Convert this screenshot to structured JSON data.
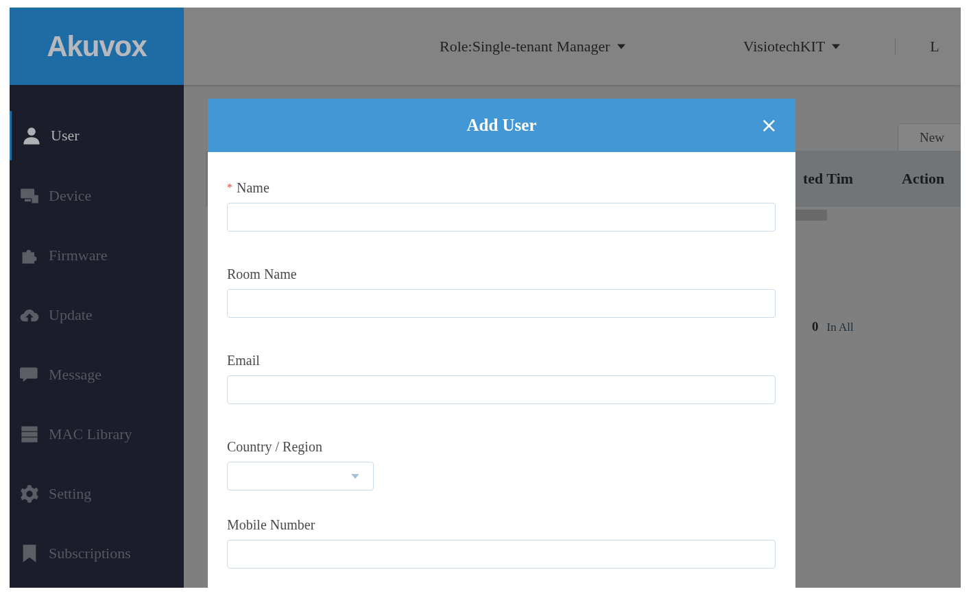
{
  "logo": "Akuvox",
  "header": {
    "role_menu": "Role:Single-tenant Manager",
    "account_menu": "VisiotechKIT",
    "cut_item": "L"
  },
  "sidebar": {
    "items": [
      {
        "label": "User",
        "selected": true
      },
      {
        "label": "Device",
        "selected": false
      },
      {
        "label": "Firmware",
        "selected": false
      },
      {
        "label": "Update",
        "selected": false
      },
      {
        "label": "Message",
        "selected": false
      },
      {
        "label": "MAC Library",
        "selected": false
      },
      {
        "label": "Setting",
        "selected": false
      },
      {
        "label": "Subscriptions",
        "selected": false
      }
    ]
  },
  "toolbar": {
    "new_button": "New"
  },
  "table": {
    "columns": [
      "ted Tim",
      "Action"
    ],
    "footer": {
      "count": "0",
      "label": "In All"
    }
  },
  "dialog": {
    "title": "Add User",
    "close": "×",
    "fields": [
      {
        "kind": "text",
        "label": "Name",
        "required_mark": "*"
      },
      {
        "kind": "text",
        "label": "Room Name"
      },
      {
        "kind": "text",
        "label": "Email"
      },
      {
        "kind": "select",
        "label": "Country / Region"
      },
      {
        "kind": "text",
        "label": "Mobile Number"
      }
    ]
  }
}
